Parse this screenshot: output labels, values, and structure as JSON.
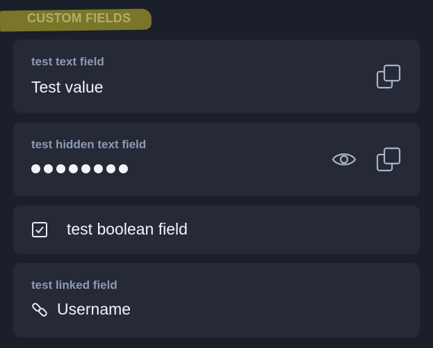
{
  "section": {
    "title": "CUSTOM FIELDS",
    "highlight_color": "#c9bd2a"
  },
  "fields": [
    {
      "type": "text",
      "label": "test text field",
      "value": "Test value",
      "actions": [
        "copy-icon"
      ]
    },
    {
      "type": "hidden",
      "label": "test hidden text field",
      "masked_dot_count": 8,
      "actions": [
        "eye-icon",
        "copy-icon"
      ]
    },
    {
      "type": "boolean",
      "label": "test boolean field",
      "checked": true,
      "icon": "checkbox-checked-icon"
    },
    {
      "type": "linked",
      "label": "test linked field",
      "value": "Username",
      "icon": "link-icon"
    }
  ],
  "colors": {
    "background": "#1a1f2a",
    "card": "#252a36",
    "label": "#8d9ab6",
    "text": "#f2f4f8",
    "icon": "#a9b4c8"
  }
}
